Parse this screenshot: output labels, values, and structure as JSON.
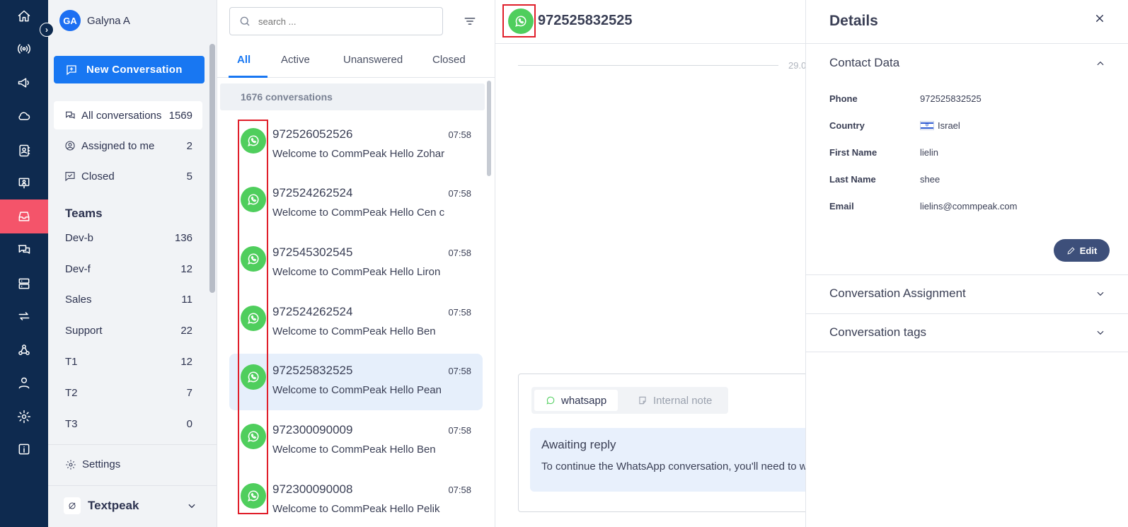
{
  "rail": {
    "items": [
      {
        "icon": "home-icon"
      },
      {
        "icon": "broadcast-icon"
      },
      {
        "icon": "megaphone-icon"
      },
      {
        "icon": "cloud-icon"
      },
      {
        "icon": "contacts-book-icon"
      },
      {
        "icon": "presentation-icon"
      },
      {
        "icon": "inbox-icon",
        "active": true
      },
      {
        "icon": "chat-bubbles-icon"
      },
      {
        "icon": "server-icon"
      },
      {
        "icon": "sync-arrows-icon"
      },
      {
        "icon": "webhook-icon"
      },
      {
        "icon": "user-icon"
      },
      {
        "icon": "settings-gear-icon"
      },
      {
        "icon": "info-icon"
      }
    ],
    "active_color": "#f4546a",
    "background": "#0e2a4f"
  },
  "sidebar": {
    "avatar_initials": "GA",
    "user_name": "Galyna A",
    "new_conversation_label": "New Conversation",
    "nav": [
      {
        "label": "All conversations",
        "count": "1569"
      },
      {
        "label": "Assigned to me",
        "count": "2"
      },
      {
        "label": "Closed",
        "count": "5"
      }
    ],
    "teams_heading": "Teams",
    "teams": [
      {
        "name": "Dev-b",
        "count": "136"
      },
      {
        "name": "Dev-f",
        "count": "12"
      },
      {
        "name": "Sales",
        "count": "11"
      },
      {
        "name": "Support",
        "count": "22"
      },
      {
        "name": "T1",
        "count": "12"
      },
      {
        "name": "T2",
        "count": "7"
      },
      {
        "name": "T3",
        "count": "0"
      }
    ],
    "settings_label": "Settings",
    "workspace_name": "Textpeak"
  },
  "list": {
    "search_placeholder": "search ...",
    "tabs": [
      "All",
      "Active",
      "Unanswered",
      "Closed"
    ],
    "active_tab": "All",
    "count_label": "1676 conversations",
    "conversations": [
      {
        "phone": "972526052526",
        "time": "07:58",
        "preview": "Welcome to CommPeak Hello Zohar"
      },
      {
        "phone": "972524262524",
        "time": "07:58",
        "preview": "Welcome to CommPeak Hello Cen c"
      },
      {
        "phone": "972545302545",
        "time": "07:58",
        "preview": "Welcome to CommPeak Hello Liron"
      },
      {
        "phone": "972524262524",
        "time": "07:58",
        "preview": "Welcome to CommPeak Hello Ben"
      },
      {
        "phone": "972525832525",
        "time": "07:58",
        "preview": "Welcome to CommPeak Hello Pean",
        "active": true
      },
      {
        "phone": "972300090009",
        "time": "07:58",
        "preview": "Welcome to CommPeak Hello Ben"
      },
      {
        "phone": "972300090008",
        "time": "07:58",
        "preview": "Welcome to CommPeak Hello Pelik"
      }
    ]
  },
  "chat": {
    "phone": "972525832525",
    "date_label": "29.0",
    "composer": {
      "tab_whatsapp": "whatsapp",
      "tab_note": "Internal note",
      "awaiting_title": "Awaiting reply",
      "awaiting_text": "To continue the WhatsApp conversation, you'll need to w"
    }
  },
  "details": {
    "title": "Details",
    "contact_section": "Contact Data",
    "fields": [
      {
        "label": "Phone",
        "value": "972525832525"
      },
      {
        "label": "Country",
        "value": "Israel"
      },
      {
        "label": "First Name",
        "value": "lielin"
      },
      {
        "label": "Last Name",
        "value": "shee"
      },
      {
        "label": "Email",
        "value": "lielins@commpeak.com"
      }
    ],
    "edit_label": "Edit",
    "assignment_section": "Conversation Assignment",
    "tags_section": "Conversation tags"
  },
  "colors": {
    "accent": "#1877f2",
    "whatsapp": "#4fce5d",
    "highlight": "#e01e2a"
  }
}
